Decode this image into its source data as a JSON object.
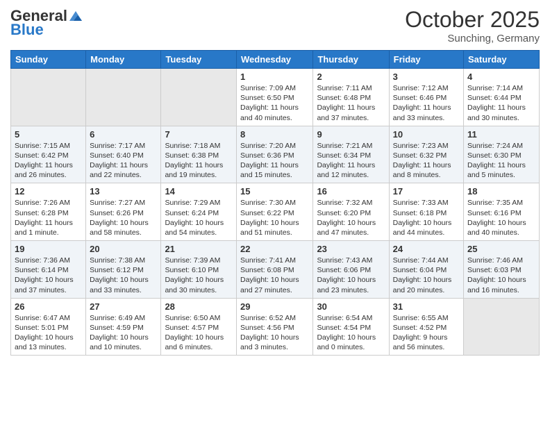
{
  "header": {
    "logo_general": "General",
    "logo_blue": "Blue",
    "month": "October 2025",
    "location": "Sunching, Germany"
  },
  "weekdays": [
    "Sunday",
    "Monday",
    "Tuesday",
    "Wednesday",
    "Thursday",
    "Friday",
    "Saturday"
  ],
  "weeks": [
    [
      {
        "day": "",
        "text": ""
      },
      {
        "day": "",
        "text": ""
      },
      {
        "day": "",
        "text": ""
      },
      {
        "day": "1",
        "text": "Sunrise: 7:09 AM\nSunset: 6:50 PM\nDaylight: 11 hours and 40 minutes."
      },
      {
        "day": "2",
        "text": "Sunrise: 7:11 AM\nSunset: 6:48 PM\nDaylight: 11 hours and 37 minutes."
      },
      {
        "day": "3",
        "text": "Sunrise: 7:12 AM\nSunset: 6:46 PM\nDaylight: 11 hours and 33 minutes."
      },
      {
        "day": "4",
        "text": "Sunrise: 7:14 AM\nSunset: 6:44 PM\nDaylight: 11 hours and 30 minutes."
      }
    ],
    [
      {
        "day": "5",
        "text": "Sunrise: 7:15 AM\nSunset: 6:42 PM\nDaylight: 11 hours and 26 minutes."
      },
      {
        "day": "6",
        "text": "Sunrise: 7:17 AM\nSunset: 6:40 PM\nDaylight: 11 hours and 22 minutes."
      },
      {
        "day": "7",
        "text": "Sunrise: 7:18 AM\nSunset: 6:38 PM\nDaylight: 11 hours and 19 minutes."
      },
      {
        "day": "8",
        "text": "Sunrise: 7:20 AM\nSunset: 6:36 PM\nDaylight: 11 hours and 15 minutes."
      },
      {
        "day": "9",
        "text": "Sunrise: 7:21 AM\nSunset: 6:34 PM\nDaylight: 11 hours and 12 minutes."
      },
      {
        "day": "10",
        "text": "Sunrise: 7:23 AM\nSunset: 6:32 PM\nDaylight: 11 hours and 8 minutes."
      },
      {
        "day": "11",
        "text": "Sunrise: 7:24 AM\nSunset: 6:30 PM\nDaylight: 11 hours and 5 minutes."
      }
    ],
    [
      {
        "day": "12",
        "text": "Sunrise: 7:26 AM\nSunset: 6:28 PM\nDaylight: 11 hours and 1 minute."
      },
      {
        "day": "13",
        "text": "Sunrise: 7:27 AM\nSunset: 6:26 PM\nDaylight: 10 hours and 58 minutes."
      },
      {
        "day": "14",
        "text": "Sunrise: 7:29 AM\nSunset: 6:24 PM\nDaylight: 10 hours and 54 minutes."
      },
      {
        "day": "15",
        "text": "Sunrise: 7:30 AM\nSunset: 6:22 PM\nDaylight: 10 hours and 51 minutes."
      },
      {
        "day": "16",
        "text": "Sunrise: 7:32 AM\nSunset: 6:20 PM\nDaylight: 10 hours and 47 minutes."
      },
      {
        "day": "17",
        "text": "Sunrise: 7:33 AM\nSunset: 6:18 PM\nDaylight: 10 hours and 44 minutes."
      },
      {
        "day": "18",
        "text": "Sunrise: 7:35 AM\nSunset: 6:16 PM\nDaylight: 10 hours and 40 minutes."
      }
    ],
    [
      {
        "day": "19",
        "text": "Sunrise: 7:36 AM\nSunset: 6:14 PM\nDaylight: 10 hours and 37 minutes."
      },
      {
        "day": "20",
        "text": "Sunrise: 7:38 AM\nSunset: 6:12 PM\nDaylight: 10 hours and 33 minutes."
      },
      {
        "day": "21",
        "text": "Sunrise: 7:39 AM\nSunset: 6:10 PM\nDaylight: 10 hours and 30 minutes."
      },
      {
        "day": "22",
        "text": "Sunrise: 7:41 AM\nSunset: 6:08 PM\nDaylight: 10 hours and 27 minutes."
      },
      {
        "day": "23",
        "text": "Sunrise: 7:43 AM\nSunset: 6:06 PM\nDaylight: 10 hours and 23 minutes."
      },
      {
        "day": "24",
        "text": "Sunrise: 7:44 AM\nSunset: 6:04 PM\nDaylight: 10 hours and 20 minutes."
      },
      {
        "day": "25",
        "text": "Sunrise: 7:46 AM\nSunset: 6:03 PM\nDaylight: 10 hours and 16 minutes."
      }
    ],
    [
      {
        "day": "26",
        "text": "Sunrise: 6:47 AM\nSunset: 5:01 PM\nDaylight: 10 hours and 13 minutes."
      },
      {
        "day": "27",
        "text": "Sunrise: 6:49 AM\nSunset: 4:59 PM\nDaylight: 10 hours and 10 minutes."
      },
      {
        "day": "28",
        "text": "Sunrise: 6:50 AM\nSunset: 4:57 PM\nDaylight: 10 hours and 6 minutes."
      },
      {
        "day": "29",
        "text": "Sunrise: 6:52 AM\nSunset: 4:56 PM\nDaylight: 10 hours and 3 minutes."
      },
      {
        "day": "30",
        "text": "Sunrise: 6:54 AM\nSunset: 4:54 PM\nDaylight: 10 hours and 0 minutes."
      },
      {
        "day": "31",
        "text": "Sunrise: 6:55 AM\nSunset: 4:52 PM\nDaylight: 9 hours and 56 minutes."
      },
      {
        "day": "",
        "text": ""
      }
    ]
  ]
}
